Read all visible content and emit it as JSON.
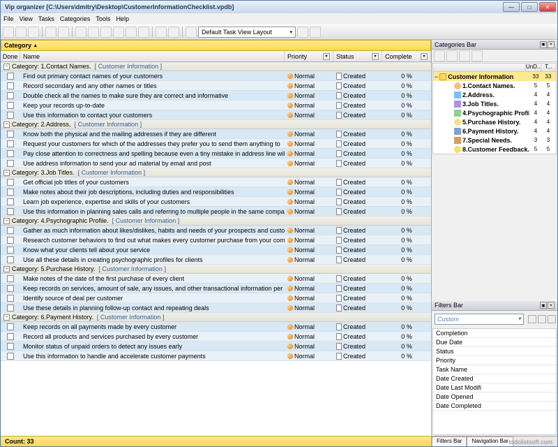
{
  "window": {
    "title": "Vip organizer [C:\\Users\\dmitry\\Desktop\\CustomerInformationChecklist.vpdb]"
  },
  "menu": [
    "File",
    "View",
    "Tasks",
    "Categories",
    "Tools",
    "Help"
  ],
  "layout_combo": "Default Task View Layout",
  "category_header": "Category",
  "columns": {
    "done": "Done",
    "name": "Name",
    "priority": "Priority",
    "status": "Status",
    "complete": "Complete"
  },
  "groups": [
    {
      "title": "Category: 1.Contact Names.",
      "breadcrumb": "[ Customer Information ]",
      "tasks": [
        {
          "name": "Find out primary contact names of your customers",
          "priority": "Normal",
          "status": "Created",
          "complete": "0 %"
        },
        {
          "name": "Record secondary and any other names or titles",
          "priority": "Normal",
          "status": "Created",
          "complete": "0 %"
        },
        {
          "name": "Double check all the names to make sure they are correct and informative",
          "priority": "Normal",
          "status": "Created",
          "complete": "0 %"
        },
        {
          "name": "Keep your records up-to-date",
          "priority": "Normal",
          "status": "Created",
          "complete": "0 %"
        },
        {
          "name": "Use this information to contact your customers",
          "priority": "Normal",
          "status": "Created",
          "complete": "0 %"
        }
      ]
    },
    {
      "title": "Category: 2.Address.",
      "breadcrumb": "[ Customer Information ]",
      "tasks": [
        {
          "name": "Know both the physical and the mailing addresses if they are different",
          "priority": "Normal",
          "status": "Created",
          "complete": "0 %"
        },
        {
          "name": "Request your customers for which of the addresses they prefer you to send them anything to",
          "priority": "Normal",
          "status": "Created",
          "complete": "0 %"
        },
        {
          "name": "Pay close attention to correctness and spelling because even a tiny mistake in address line will fail delivery of your",
          "priority": "Normal",
          "status": "Created",
          "complete": "0 %"
        },
        {
          "name": "Use address information to send your ad material by email and post",
          "priority": "Normal",
          "status": "Created",
          "complete": "0 %"
        }
      ]
    },
    {
      "title": "Category: 3.Job Titles.",
      "breadcrumb": "[ Customer Information ]",
      "tasks": [
        {
          "name": "Get official job titles of your customers",
          "priority": "Normal",
          "status": "Created",
          "complete": "0 %"
        },
        {
          "name": "Make notes about their job descriptions, including duties and responsibilities",
          "priority": "Normal",
          "status": "Created",
          "complete": "0 %"
        },
        {
          "name": "Learn job experience, expertise and skills of your customers",
          "priority": "Normal",
          "status": "Created",
          "complete": "0 %"
        },
        {
          "name": "Use this information in planning sales calls and referring to multiple people in the same company",
          "priority": "Normal",
          "status": "Created",
          "complete": "0 %"
        }
      ]
    },
    {
      "title": "Category: 4.Psychographic Profile.",
      "breadcrumb": "[ Customer Information ]",
      "tasks": [
        {
          "name": "Gather as much information about likes/dislikes, habits and needs of your prospects and customers as possible",
          "priority": "Normal",
          "status": "Created",
          "complete": "0 %"
        },
        {
          "name": "Research customer behaviors to find out what makes every customer purchase from your company",
          "priority": "Normal",
          "status": "Created",
          "complete": "0 %"
        },
        {
          "name": "Know what your clients tell about your service",
          "priority": "Normal",
          "status": "Created",
          "complete": "0 %"
        },
        {
          "name": "Use all these details in creating psychographic profiles for clients",
          "priority": "Normal",
          "status": "Created",
          "complete": "0 %"
        }
      ]
    },
    {
      "title": "Category: 5.Purchase History.",
      "breadcrumb": "[ Customer Information ]",
      "tasks": [
        {
          "name": "Make notes of the date of the first purchase of every client",
          "priority": "Normal",
          "status": "Created",
          "complete": "0 %"
        },
        {
          "name": "Keep records on services, amount of sale, any issues, and other transactional information per customer",
          "priority": "Normal",
          "status": "Created",
          "complete": "0 %"
        },
        {
          "name": "Identify source of deal per customer",
          "priority": "Normal",
          "status": "Created",
          "complete": "0 %"
        },
        {
          "name": "Use these details in planning follow-up contact and repeating deals",
          "priority": "Normal",
          "status": "Created",
          "complete": "0 %"
        }
      ]
    },
    {
      "title": "Category: 6.Payment History.",
      "breadcrumb": "[ Customer Information ]",
      "tasks": [
        {
          "name": "Keep records on all payments made by every customer",
          "priority": "Normal",
          "status": "Created",
          "complete": "0 %"
        },
        {
          "name": "Record all products and services purchased by every customer",
          "priority": "Normal",
          "status": "Created",
          "complete": "0 %"
        },
        {
          "name": "Monitor status of unpaid orders to detect any issues early",
          "priority": "Normal",
          "status": "Created",
          "complete": "0 %"
        },
        {
          "name": "Use this information to handle and accelerate customer payments",
          "priority": "Normal",
          "status": "Created",
          "complete": "0 %"
        }
      ]
    }
  ],
  "count_label": "Count: 33",
  "categories_bar": {
    "title": "Categories Bar",
    "header_cols": [
      "",
      "UnD...",
      "T..."
    ],
    "root": {
      "label": "Customer Information",
      "c1": "33",
      "c2": "33"
    },
    "items": [
      {
        "label": "1.Contact Names.",
        "c1": "5",
        "c2": "5",
        "ic": "i1"
      },
      {
        "label": "2.Address.",
        "c1": "4",
        "c2": "4",
        "ic": "i2"
      },
      {
        "label": "3.Job Titles.",
        "c1": "4",
        "c2": "4",
        "ic": "i3"
      },
      {
        "label": "4.Psychographic Profile.",
        "c1": "4",
        "c2": "4",
        "ic": "i4"
      },
      {
        "label": "5.Purchase History.",
        "c1": "4",
        "c2": "4",
        "ic": "i5"
      },
      {
        "label": "6.Payment History.",
        "c1": "4",
        "c2": "4",
        "ic": "i6"
      },
      {
        "label": "7.Special Needs.",
        "c1": "3",
        "c2": "3",
        "ic": "i7"
      },
      {
        "label": "8.Customer Feedback.",
        "c1": "5",
        "c2": "5",
        "ic": "i8"
      }
    ]
  },
  "filters_bar": {
    "title": "Filters Bar",
    "combo": "Custom",
    "items": [
      "Completion",
      "Due Date",
      "Status",
      "Priority",
      "Task Name",
      "Date Created",
      "Date Last Modifi",
      "Date Opened",
      "Date Completed"
    ]
  },
  "bottom_tabs": [
    "Filters Bar",
    "Navigation Bar"
  ],
  "footer": "todolistsoft.com"
}
